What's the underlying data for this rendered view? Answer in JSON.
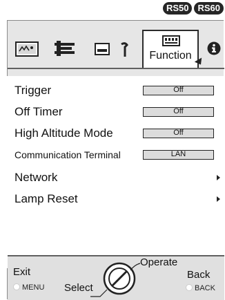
{
  "badges": [
    "RS50",
    "RS60"
  ],
  "tabs": {
    "picture": "picture-adjust-icon",
    "input": "input-settings-icon",
    "installation": "installation-icon",
    "display": "display-setup-icon",
    "function_label": "Function",
    "function_icon": "function-icon",
    "info": "information-icon"
  },
  "menu": {
    "trigger": {
      "label": "Trigger",
      "value": "Off"
    },
    "off_timer": {
      "label": "Off Timer",
      "value": "Off"
    },
    "high_altitude": {
      "label": "High Altitude Mode",
      "value": "Off"
    },
    "comm_terminal": {
      "label": "Communication Terminal",
      "value": "LAN"
    },
    "network": {
      "label": "Network"
    },
    "lamp_reset": {
      "label": "Lamp Reset"
    }
  },
  "footer": {
    "exit": "Exit",
    "menu": "MENU",
    "select": "Select",
    "operate": "Operate",
    "back": "Back",
    "back_key": "BACK"
  }
}
